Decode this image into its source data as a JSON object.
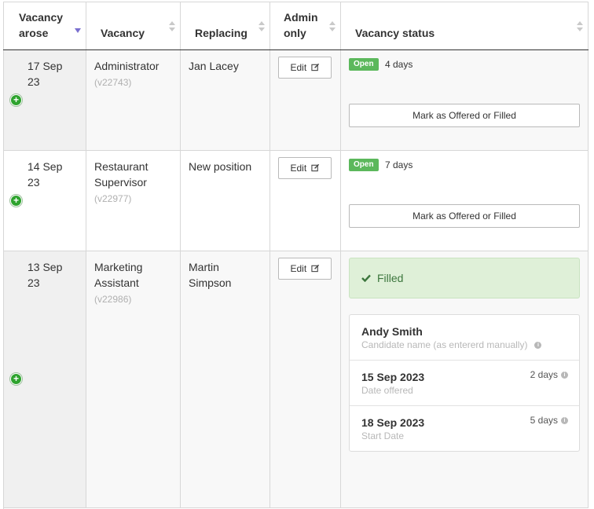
{
  "headers": {
    "vacancy_arose_l1": "Vacancy",
    "vacancy_arose_l2": "arose",
    "vacancy": "Vacancy",
    "replacing": "Replacing",
    "admin_l1": "Admin",
    "admin_l2": "only",
    "status": "Vacancy status"
  },
  "rows": [
    {
      "date_l1": "17 Sep",
      "date_l2": "23",
      "vacancy_l1": "Administrator",
      "vacancy_l2": "",
      "ref": "(v22743)",
      "replacing_l1": "Jan Lacey",
      "replacing_l2": "",
      "edit_label": "Edit",
      "status_badge": "Open",
      "status_days": "4 days",
      "mark_label": "Mark as Offered or Filled"
    },
    {
      "date_l1": "14 Sep",
      "date_l2": "23",
      "vacancy_l1": "Restaurant",
      "vacancy_l2": "Supervisor",
      "ref": "(v22977)",
      "replacing_l1": "New position",
      "replacing_l2": "",
      "edit_label": "Edit",
      "status_badge": "Open",
      "status_days": "7 days",
      "mark_label": "Mark as Offered or Filled"
    },
    {
      "date_l1": "13 Sep",
      "date_l2": "23",
      "vacancy_l1": "Marketing",
      "vacancy_l2": "Assistant",
      "ref": "(v22986)",
      "replacing_l1": "Martin",
      "replacing_l2": "Simpson",
      "edit_label": "Edit",
      "filled_label": "Filled",
      "candidate_name": "Andy Smith",
      "candidate_caption": "Candidate name (as entererd manually)",
      "offered_date": "15 Sep 2023",
      "offered_caption": "Date offered",
      "offered_days": "2 days",
      "start_date": "18 Sep 2023",
      "start_caption": "Start Date",
      "start_days": "5 days"
    }
  ],
  "colors": {
    "open_badge": "#5cb85c",
    "filled_bg": "#dff0d8",
    "filled_text": "#3c763d",
    "add_icon": "#2ea32e",
    "sort_active": "#7a6fcf"
  },
  "icons": [
    "sort-desc-icon",
    "sort-icon",
    "add-icon",
    "edit-icon",
    "check-icon",
    "info-icon"
  ]
}
